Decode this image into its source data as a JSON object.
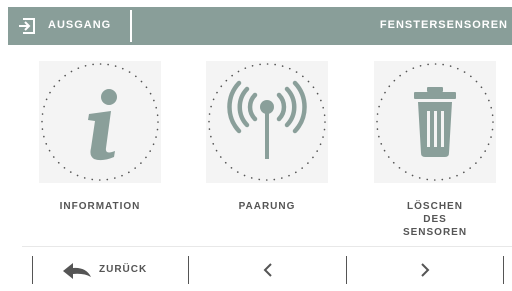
{
  "header": {
    "exit_label": "AUSGANG",
    "title": "FENSTERSENSOREN",
    "background": "#899e99"
  },
  "tiles": [
    {
      "icon": "info-icon",
      "label_lines": [
        "INFORMATION"
      ]
    },
    {
      "icon": "signal-antenna-icon",
      "label_lines": [
        "PAARUNG"
      ]
    },
    {
      "icon": "trash-icon",
      "label_lines": [
        "LÖSCHEN",
        "DES",
        "SENSOREN"
      ]
    }
  ],
  "footer": {
    "back_label": "ZURÜCK",
    "prev_icon": "chevron-left-icon",
    "next_icon": "chevron-right-icon"
  },
  "colors": {
    "icon": "#8a9f9a",
    "tile_bg": "#f4f4f4",
    "text": "#555555"
  }
}
